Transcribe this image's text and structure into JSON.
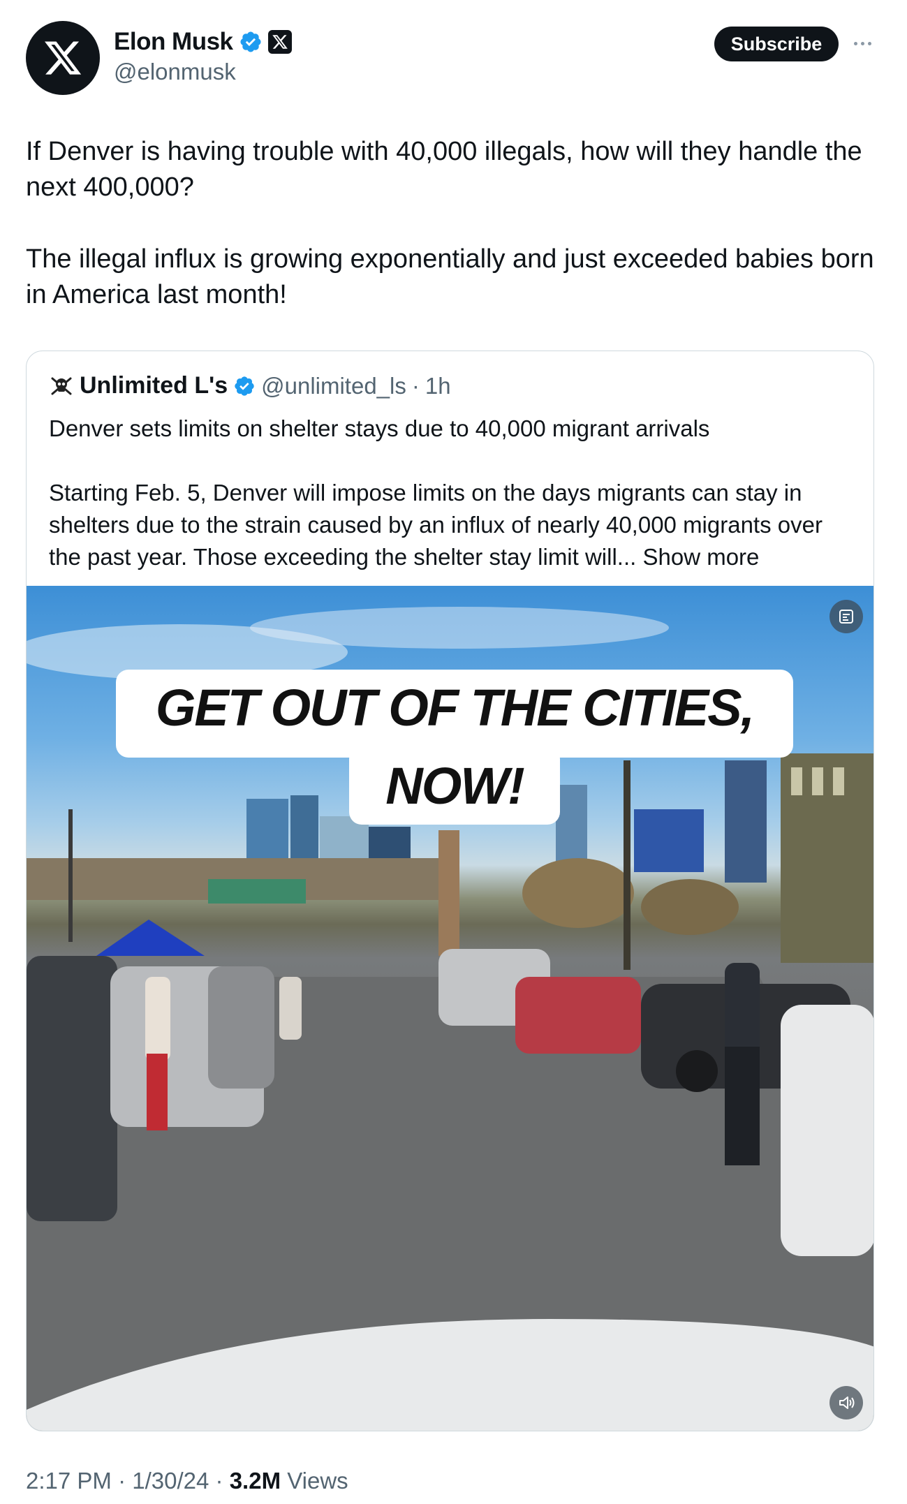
{
  "author": {
    "name": "Elon Musk",
    "handle": "@elonmusk",
    "avatar_icon": "x-logo-icon",
    "badges": [
      "verified-icon",
      "x-affiliate-icon"
    ]
  },
  "actions": {
    "subscribe_label": "Subscribe",
    "more_icon": "more-dots-icon"
  },
  "tweet": {
    "paragraphs": [
      "If Denver is having trouble with 40,000 illegals, how will they handle the next 400,000?",
      "The illegal influx is growing exponentially and just exceeded babies born in America last month!"
    ]
  },
  "quote": {
    "name": "Unlimited L's",
    "handle": "@unlimited_ls",
    "separator": "·",
    "time": "1h",
    "headline": "Denver sets limits on shelter stays due to 40,000 migrant arrivals",
    "body": "Starting Feb. 5, Denver will impose limits on the days migrants can stay in shelters due to the strain caused by an influx of nearly 40,000 migrants over the past year. Those exceeding the shelter stay limit will...",
    "show_more": "Show more",
    "video": {
      "caption_line1": "GET OUT OF THE CITIES,",
      "caption_line2": "NOW!",
      "top_right_icon": "ai-label-icon",
      "bottom_right_icon": "volume-icon"
    }
  },
  "meta": {
    "time": "2:17 PM",
    "date": "1/30/24",
    "views_count": "3.2M",
    "views_label": "Views",
    "sep": "·"
  }
}
